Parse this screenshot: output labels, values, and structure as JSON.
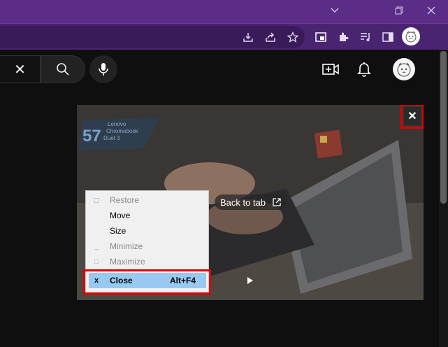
{
  "browser": {
    "window_controls": [
      "chevron-down",
      "restore",
      "close"
    ],
    "toolbar_icons": [
      "install-app-icon",
      "share-icon",
      "bookmark-star-icon",
      "pip-icon",
      "extensions-icon",
      "media-queue-icon",
      "side-panel-icon",
      "profile-avatar-icon"
    ],
    "accent": "#5b2d86"
  },
  "youtube_header": {
    "clear_symbol": "✕"
  },
  "pip": {
    "back_to_tab_label": "Back to tab",
    "close_symbol": "✕",
    "thumbnail_caption_line1": "Lenovo",
    "thumbnail_caption_line2": "Chromebook",
    "thumbnail_caption_line3": "Duet 3"
  },
  "context_menu": {
    "items": [
      {
        "icon": "▢",
        "label": "Restore",
        "disabled": true
      },
      {
        "icon": "",
        "label": "Move",
        "disabled": false
      },
      {
        "icon": "",
        "label": "Size",
        "disabled": false
      },
      {
        "icon": "_",
        "label": "Minimize",
        "disabled": true
      },
      {
        "icon": "□",
        "label": "Maximize",
        "disabled": true
      }
    ],
    "close": {
      "icon": "x",
      "label": "Close",
      "shortcut": "Alt+F4"
    },
    "highlight_color": "#99c9f1",
    "callout_color": "#e00000"
  }
}
